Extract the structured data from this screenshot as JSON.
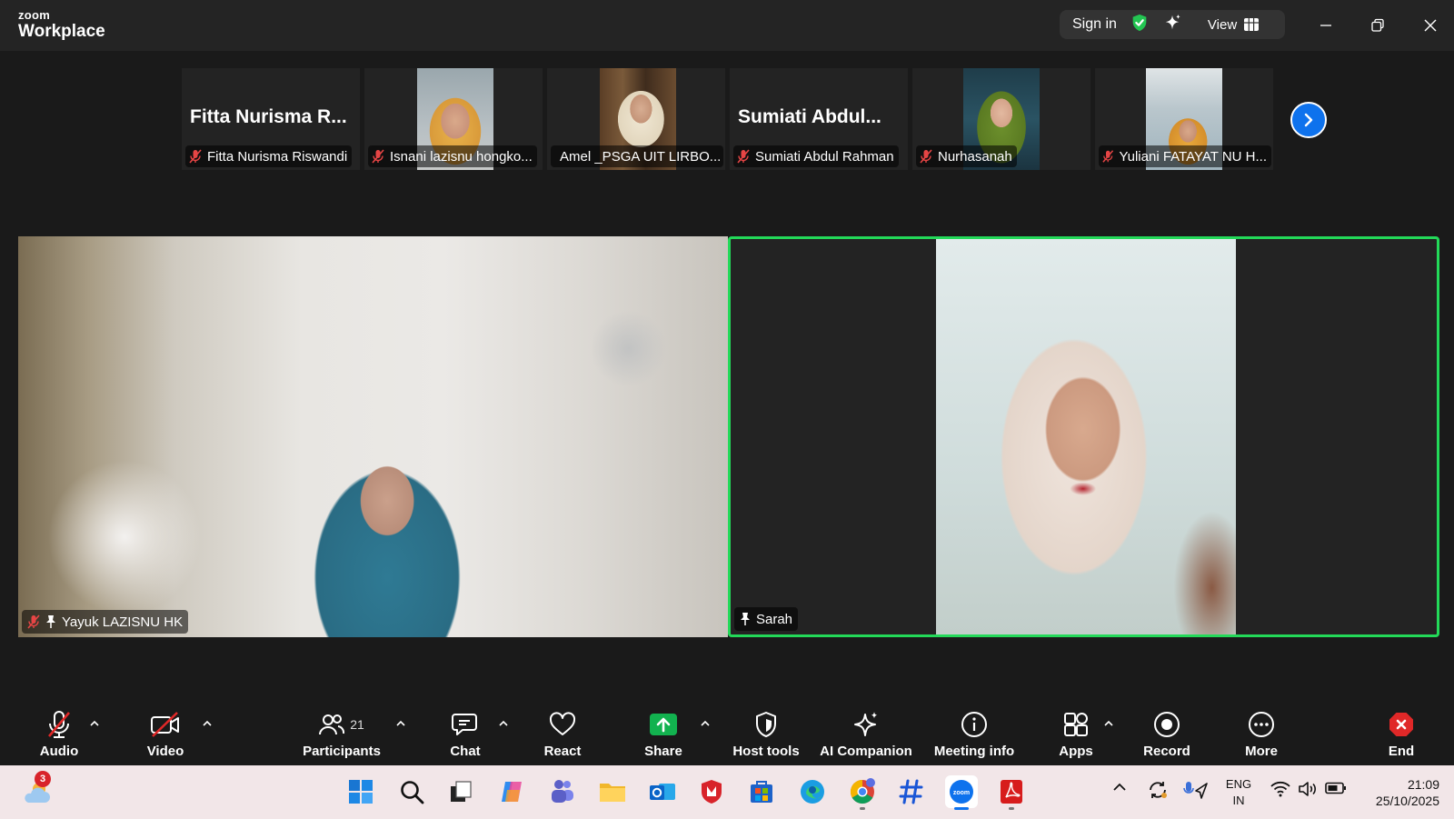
{
  "app": {
    "brand_top": "zoom",
    "brand_bottom": "Workplace"
  },
  "titlebar": {
    "signin_label": "Sign in",
    "view_label": "View"
  },
  "thumbnails": [
    {
      "big_name": "Fitta Nurisma R...",
      "label": "Fitta Nurisma Riswandi",
      "has_video": false
    },
    {
      "big_name": "",
      "label": "Isnani lazisnu hongko...",
      "has_video": true
    },
    {
      "big_name": "",
      "label": "Amel _PSGA UIT LIRBO...",
      "has_video": true
    },
    {
      "big_name": "Sumiati Abdul...",
      "label": "Sumiati Abdul Rahman",
      "has_video": false
    },
    {
      "big_name": "",
      "label": "Nurhasanah",
      "has_video": true
    },
    {
      "big_name": "",
      "label": "Yuliani FATAYAT NU H...",
      "has_video": true
    }
  ],
  "stage": {
    "left_tile": {
      "name": "Yayuk LAZISNU HK"
    },
    "right_tile": {
      "name": "Sarah",
      "active_speaker_color": "#23d959"
    }
  },
  "toolbar": {
    "audio": "Audio",
    "video": "Video",
    "participants": "Participants",
    "participants_count": "21",
    "chat": "Chat",
    "react": "React",
    "share": "Share",
    "host_tools": "Host tools",
    "ai_companion": "AI Companion",
    "meeting_info": "Meeting info",
    "apps": "Apps",
    "record": "Record",
    "more": "More",
    "end": "End"
  },
  "taskbar": {
    "weather_badge": "3",
    "lang_top": "ENG",
    "lang_bottom": "IN",
    "time": "21:09",
    "date": "25/10/2025"
  },
  "colors": {
    "zoom_blue": "#0e72ed",
    "share_green": "#12b24f",
    "end_red": "#e02828",
    "muted_red": "#e64545"
  }
}
